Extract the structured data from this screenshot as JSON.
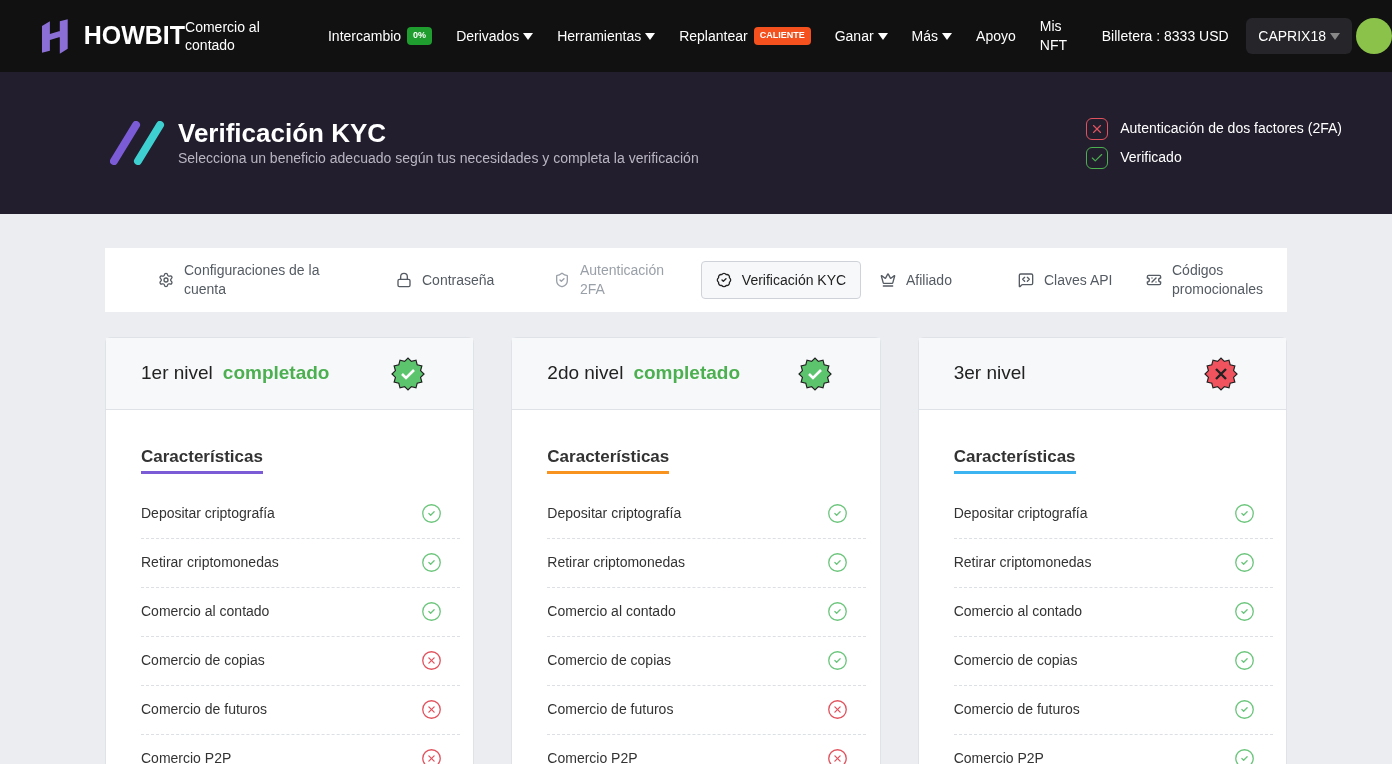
{
  "nav": {
    "logo": "HOWBIT",
    "subtitle": "Comercio al contado",
    "items": [
      {
        "label": "Intercambio",
        "kind": "badge",
        "badge": "0%",
        "color": "#1f9d2f"
      },
      {
        "label": "Derivados",
        "kind": "dropdown"
      },
      {
        "label": "Herramientas",
        "kind": "dropdown"
      },
      {
        "label": "Replantear",
        "kind": "badge",
        "badge": "CALIENTE",
        "color": "#f4511e"
      },
      {
        "label": "Ganar",
        "kind": "dropdown"
      },
      {
        "label": "Más",
        "kind": "dropdown"
      },
      {
        "label": "Apoyo",
        "kind": "link"
      },
      {
        "label": "Mis NFT",
        "kind": "link"
      }
    ],
    "wallet": "Billetera : 8333 USD",
    "user": "CAPRIX18"
  },
  "header": {
    "title": "Verificación KYC",
    "subtitle": "Selecciona un beneficio adecuado según tus necesidades y completa la verificación",
    "status": [
      {
        "label": "Autenticación de dos factores (2FA)",
        "ok": false
      },
      {
        "label": "Verificado",
        "ok": true
      }
    ]
  },
  "tabs": [
    {
      "label": "Configuraciones de la cuenta",
      "selected": false,
      "disabled": false
    },
    {
      "label": "Contraseña",
      "selected": false,
      "disabled": false
    },
    {
      "label": "Autenticación 2FA",
      "selected": false,
      "disabled": true
    },
    {
      "label": "Verificación KYC",
      "selected": true,
      "disabled": false
    },
    {
      "label": "Afiliado",
      "selected": false,
      "disabled": false
    },
    {
      "label": "Claves API",
      "selected": false,
      "disabled": false
    },
    {
      "label": "Códigos promocionales",
      "selected": false,
      "disabled": false
    }
  ],
  "levels": [
    {
      "title": "1er nivel",
      "status": "completado",
      "completed": true,
      "heading": "Características",
      "color": "#7b5cd6",
      "features": [
        {
          "label": "Depositar criptografía",
          "ok": true
        },
        {
          "label": "Retirar criptomonedas",
          "ok": true
        },
        {
          "label": "Comercio al contado",
          "ok": true
        },
        {
          "label": "Comercio de copias",
          "ok": false
        },
        {
          "label": "Comercio de futuros",
          "ok": false
        },
        {
          "label": "Comercio P2P",
          "ok": false
        }
      ]
    },
    {
      "title": "2do nivel",
      "status": "completado",
      "completed": true,
      "heading": "Características",
      "color": "#f7931e",
      "features": [
        {
          "label": "Depositar criptografía",
          "ok": true
        },
        {
          "label": "Retirar criptomonedas",
          "ok": true
        },
        {
          "label": "Comercio al contado",
          "ok": true
        },
        {
          "label": "Comercio de copias",
          "ok": true
        },
        {
          "label": "Comercio de futuros",
          "ok": false
        },
        {
          "label": "Comercio P2P",
          "ok": false
        }
      ]
    },
    {
      "title": "3er nivel",
      "completed": false,
      "heading": "Características",
      "color": "#3db4f2",
      "features": [
        {
          "label": "Depositar criptografía",
          "ok": true
        },
        {
          "label": "Retirar criptomonedas",
          "ok": true
        },
        {
          "label": "Comercio al contado",
          "ok": true
        },
        {
          "label": "Comercio de copias",
          "ok": true
        },
        {
          "label": "Comercio de futuros",
          "ok": true
        },
        {
          "label": "Comercio P2P",
          "ok": true
        }
      ]
    }
  ]
}
